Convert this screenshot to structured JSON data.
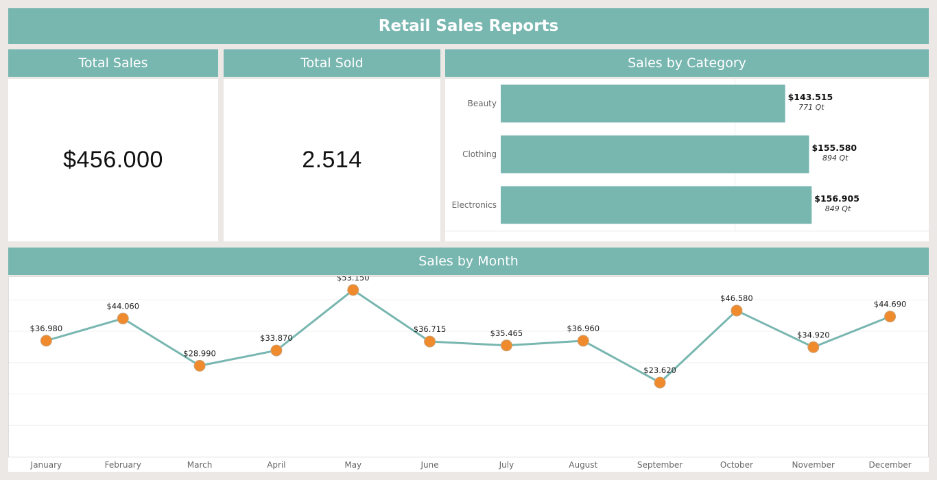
{
  "dashboard": {
    "title": "Retail Sales Reports"
  },
  "kpis": {
    "total_sales": {
      "label": "Total Sales",
      "value": "$456.000"
    },
    "total_sold": {
      "label": "Total Sold",
      "value": "2.514"
    }
  },
  "category_panel": {
    "title": "Sales by Category"
  },
  "month_panel": {
    "title": "Sales by Month"
  },
  "colors": {
    "accent": "#78b6b0",
    "marker": "#ef8b2c",
    "line": "#78b6b0"
  },
  "chart_data": [
    {
      "type": "bar",
      "orientation": "horizontal",
      "title": "Sales by Category",
      "categories": [
        "Beauty",
        "Clothing",
        "Electronics"
      ],
      "values": [
        143515,
        155580,
        156905
      ],
      "value_labels": [
        "$143.515",
        "$155.580",
        "$156.905"
      ],
      "quantity_labels": [
        "771 Qt",
        "894 Qt",
        "849 Qt"
      ],
      "xlim": [
        0,
        180000
      ],
      "grid": true
    },
    {
      "type": "line",
      "title": "Sales by Month",
      "categories": [
        "January",
        "February",
        "March",
        "April",
        "May",
        "June",
        "July",
        "August",
        "September",
        "October",
        "November",
        "December"
      ],
      "values": [
        36980,
        44060,
        28990,
        33870,
        53150,
        36715,
        35465,
        36960,
        23620,
        46580,
        34920,
        44690
      ],
      "value_labels": [
        "$36.980",
        "$44.060",
        "$28.990",
        "$33.870",
        "$53.150",
        "$36.715",
        "$35.465",
        "$36.960",
        "$23.620",
        "$46.580",
        "$34.920",
        "$44.690"
      ],
      "ylim": [
        0,
        57500
      ],
      "grid": true,
      "markers": true
    }
  ]
}
